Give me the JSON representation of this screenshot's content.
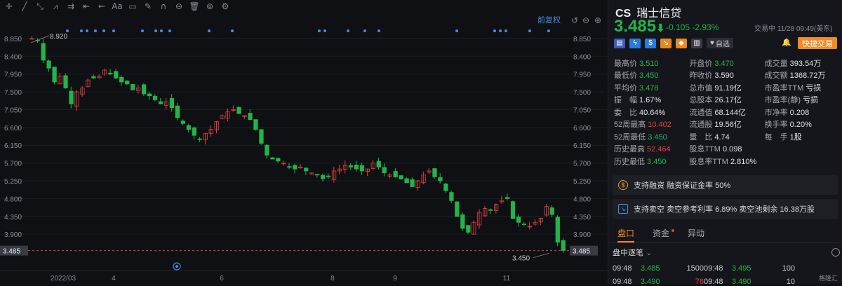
{
  "toolbar": {
    "icons": [
      "crosshair-icon",
      "line-icon",
      "ray-icon",
      "polyline-icon",
      "parallel-icon",
      "measure-icon",
      "arrow-left-icon",
      "text-icon",
      "rect-icon",
      "pen-icon",
      "magnet-icon",
      "eye-icon",
      "trash-icon",
      "layers-icon",
      "settings-icon"
    ],
    "glyphs": [
      "✛",
      "╱",
      "⤡",
      "⩘",
      "⇉",
      "⇤",
      "←",
      "Aa",
      "▭",
      "✎",
      "∩",
      "⊖",
      "🗑",
      "⊚",
      "⚙"
    ]
  },
  "chart": {
    "restore_label": "前复权",
    "current_price_label": "3.485",
    "max_label": "8.920",
    "min_label": "3.450",
    "right_axis_current": "3.485",
    "x_ticks": [
      "2022/03",
      "4",
      "6",
      "8",
      "9",
      "11"
    ]
  },
  "chart_data": {
    "type": "candlestick",
    "yticks": [
      8.85,
      8.4,
      7.95,
      7.5,
      7.05,
      6.6,
      6.15,
      5.7,
      5.25,
      4.8,
      4.35,
      3.9
    ],
    "ytick_labels": [
      "8.850",
      "8.400",
      "7.950",
      "7.500",
      "7.050",
      "6.600",
      "6.150",
      "5.700",
      "5.250",
      "4.800",
      "4.350",
      "3.900"
    ],
    "ylim": [
      3.3,
      9.15
    ],
    "x_tick_labels": [
      "2022/03",
      "4",
      "6",
      "8",
      "9",
      "11"
    ],
    "price_path": [
      8.85,
      8.8,
      8.3,
      8.1,
      7.75,
      7.9,
      7.6,
      7.2,
      7.5,
      7.6,
      7.8,
      7.85,
      7.9,
      8.05,
      7.95,
      7.85,
      7.75,
      7.7,
      7.55,
      7.6,
      7.45,
      7.4,
      7.3,
      7.2,
      7.25,
      7.1,
      6.85,
      6.7,
      6.55,
      6.4,
      6.3,
      6.45,
      6.55,
      6.75,
      6.9,
      7.0,
      7.05,
      6.95,
      6.9,
      6.8,
      6.55,
      6.2,
      5.9,
      5.8,
      5.75,
      5.7,
      5.6,
      5.55,
      5.6,
      5.5,
      5.45,
      5.4,
      5.3,
      5.35,
      5.5,
      5.55,
      5.65,
      5.6,
      5.55,
      5.5,
      5.55,
      5.7,
      5.6,
      5.45,
      5.4,
      5.35,
      5.3,
      5.2,
      5.1,
      5.25,
      5.4,
      5.5,
      5.35,
      5.25,
      5.0,
      4.75,
      4.35,
      4.05,
      3.95,
      4.2,
      4.45,
      4.55,
      4.5,
      4.65,
      4.75,
      4.8,
      4.3,
      4.2,
      4.15,
      4.1,
      4.2,
      4.3,
      4.6,
      4.4,
      3.7,
      3.485
    ],
    "current": 3.485,
    "high_marker": 8.92,
    "low_marker": 3.45
  },
  "stock": {
    "ticker": "CS",
    "name": "瑞士信贷",
    "price": "3.485",
    "arrow": "⬇",
    "change": "-0.105 -2.93%",
    "status": "交易中 11/28 09:49(美东)",
    "watchlist_label": "自选",
    "quick_trade_label": "快捷交易"
  },
  "stats": [
    [
      {
        "k": "最高价",
        "v": "3.510",
        "c": "g"
      },
      {
        "k": "开盘价",
        "v": "3.470",
        "c": "g"
      },
      {
        "k": "成交量",
        "v": "393.54万",
        "c": ""
      }
    ],
    [
      {
        "k": "最低价",
        "v": "3.450",
        "c": "g"
      },
      {
        "k": "昨收价",
        "v": "3.590",
        "c": ""
      },
      {
        "k": "成交额",
        "v": "1368.72万",
        "c": ""
      }
    ],
    [
      {
        "k": "平均价",
        "v": "3.478",
        "c": "g"
      },
      {
        "k": "总市值",
        "v": "91.19亿",
        "c": ""
      },
      {
        "k": "市盈率TTM",
        "v": "亏损",
        "c": ""
      }
    ],
    [
      {
        "k": "振　幅",
        "v": "1.67%",
        "c": ""
      },
      {
        "k": "总股本",
        "v": "26.17亿",
        "c": ""
      },
      {
        "k": "市盈率(静)",
        "v": "亏损",
        "c": ""
      }
    ],
    [
      {
        "k": "委　比",
        "v": "40.64%",
        "c": ""
      },
      {
        "k": "流通值",
        "v": "68.144亿",
        "c": ""
      },
      {
        "k": "市净率",
        "v": "0.208",
        "c": ""
      }
    ],
    [
      {
        "k": "52周最高",
        "v": "10.402",
        "c": "r"
      },
      {
        "k": "流通股",
        "v": "19.56亿",
        "c": ""
      },
      {
        "k": "换手率",
        "v": "0.20%",
        "c": ""
      }
    ],
    [
      {
        "k": "52周最低",
        "v": "3.450",
        "c": "g"
      },
      {
        "k": "量　比",
        "v": "4.74",
        "c": ""
      },
      {
        "k": "每　手",
        "v": "1股",
        "c": ""
      }
    ],
    [
      {
        "k": "历史最高",
        "v": "52.464",
        "c": "r"
      },
      {
        "k": "股息TTM",
        "v": "0.098",
        "c": ""
      },
      {
        "k": "",
        "v": "",
        "c": ""
      }
    ],
    [
      {
        "k": "历史最低",
        "v": "3.450",
        "c": "g"
      },
      {
        "k": "股息率TTM",
        "v": "2.810%",
        "c": ""
      },
      {
        "k": "",
        "v": "",
        "c": ""
      }
    ]
  ],
  "cards": {
    "margin": "支持融资 融资保证金率 50%",
    "short": "支持卖空 卖空参考利率 6.89% 卖空池剩余 16.38万股"
  },
  "tabs": [
    "盘口",
    "资金",
    "异动"
  ],
  "ticks": {
    "title": "盘中逐笔",
    "rows": [
      [
        "09:48",
        "3.485",
        "1500",
        "09:48",
        "3.495",
        "100"
      ],
      [
        "09:48",
        "3.490",
        "76",
        "09:48",
        "3.490",
        "10"
      ]
    ]
  },
  "watermark": "格隆汇",
  "colors": {
    "up": "#e04040",
    "down": "#22b44a",
    "accent": "#f08a24",
    "background": "#0f1014"
  }
}
